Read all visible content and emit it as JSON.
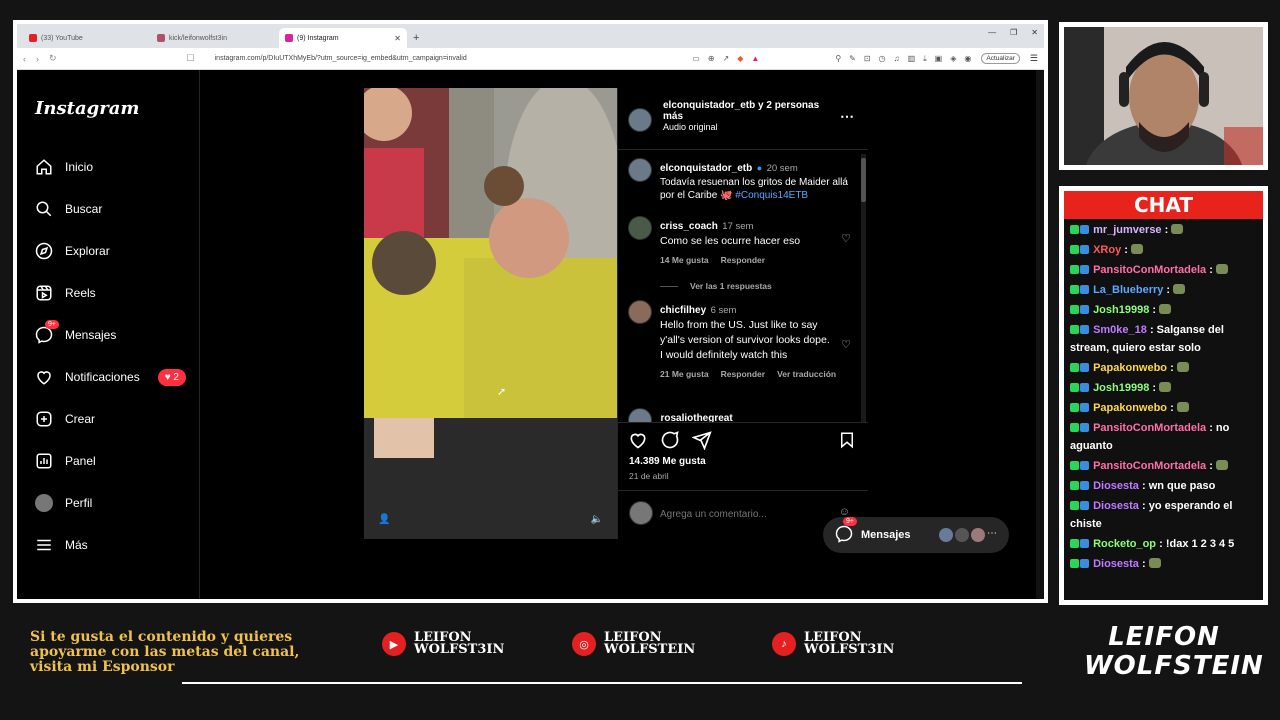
{
  "browser": {
    "tabs": [
      {
        "label": "(33) YouTube",
        "color": "#e52020"
      },
      {
        "label": "kick/leifonwolfst3in",
        "color": "#b0506a"
      },
      {
        "label": "(9) Instagram",
        "color": "#d6249f"
      }
    ],
    "url": "instagram.com/p/DIuUTXhMyEb/?utm_source=ig_embed&utm_campaign=invalid",
    "update_label": "Actualizar"
  },
  "instagram": {
    "logo": "Instagram",
    "nav": [
      {
        "label": "Inicio",
        "icon": "home-icon"
      },
      {
        "label": "Buscar",
        "icon": "search-icon"
      },
      {
        "label": "Explorar",
        "icon": "compass-icon"
      },
      {
        "label": "Reels",
        "icon": "reels-icon"
      },
      {
        "label": "Mensajes",
        "icon": "messenger-icon",
        "badge": "9+"
      },
      {
        "label": "Notificaciones",
        "icon": "heart-icon",
        "pill": "2"
      },
      {
        "label": "Crear",
        "icon": "plus-square-icon"
      },
      {
        "label": "Panel",
        "icon": "chart-icon"
      },
      {
        "label": "Perfil",
        "icon": "avatar-icon"
      },
      {
        "label": "Más",
        "icon": "menu-icon"
      }
    ],
    "post": {
      "header_title": "elconquistador_etb y 2 personas más",
      "header_sub": "Audio original",
      "caption_author": "elconquistador_etb",
      "caption_time": "20 sem",
      "caption_text": "Todavía resuenan los gritos de Maider allá por el Caribe",
      "caption_tag": "#Conquis14ETB",
      "comments": [
        {
          "author": "criss_coach",
          "time": "17 sem",
          "text": "Como se les ocurre hacer eso",
          "likes": "14 Me gusta",
          "reply": "Responder",
          "replies": "Ver las 1 respuestas"
        },
        {
          "author": "chicfilhey",
          "time": "6 sem",
          "text": "Hello from the US. Just like to say y'all's version of survivor looks dope. I would definitely watch this",
          "likes": "21 Me gusta",
          "reply": "Responder",
          "translate": "Ver traducción"
        }
      ],
      "partial_author": "rosaliothegreat",
      "likes": "14.389 Me gusta",
      "date": "21 de abril",
      "comment_placeholder": "Agrega un comentario..."
    },
    "messages_pill": {
      "label": "Mensajes",
      "badge": "9+"
    }
  },
  "chat": {
    "title": "CHAT",
    "messages": [
      {
        "user": "mr_jumverse",
        "color": "#d8b4ff",
        "text": ""
      },
      {
        "user": "XRoy",
        "color": "#ff5a5a",
        "text": ""
      },
      {
        "user": "PansitoConMortadela",
        "color": "#ff6fa8",
        "text": ""
      },
      {
        "user": "La_Blueberry",
        "color": "#5aa8ff",
        "text": ""
      },
      {
        "user": "Josh19998",
        "color": "#8cff7a",
        "text": ""
      },
      {
        "user": "Sm0ke_18",
        "color": "#c07aff",
        "text": "Salganse del stream, quiero estar solo"
      },
      {
        "user": "Papakonwebo",
        "color": "#ffd84a",
        "text": ""
      },
      {
        "user": "Josh19998",
        "color": "#8cff7a",
        "text": ""
      },
      {
        "user": "Papakonwebo",
        "color": "#ffd84a",
        "text": ""
      },
      {
        "user": "PansitoConMortadela",
        "color": "#ff6fa8",
        "text": "no aguanto"
      },
      {
        "user": "PansitoConMortadela",
        "color": "#ff6fa8",
        "text": ""
      },
      {
        "user": "Diosesta",
        "color": "#c07aff",
        "text": "wn que paso"
      },
      {
        "user": "Diosesta",
        "color": "#c07aff",
        "text": "yo esperando el chiste"
      },
      {
        "user": "Rocketo_op",
        "color": "#8cff7a",
        "text": "!dax 1 2 3 4 5"
      },
      {
        "user": "Diosesta",
        "color": "#c07aff",
        "text": ""
      }
    ]
  },
  "overlay": {
    "promo": "Si te gusta el contenido y quieres apoyarme con las metas del canal, visita mi Esponsor",
    "socials": [
      {
        "icon": "youtube-icon",
        "line1": "LEIFON",
        "line2": "WOLFST3IN"
      },
      {
        "icon": "instagram-icon",
        "line1": "LEIFON",
        "line2": "WOLFSTEIN"
      },
      {
        "icon": "tiktok-icon",
        "line1": "LEIFON",
        "line2": "WOLFST3IN"
      }
    ],
    "brand_line1": "LEIFON",
    "brand_line2": "WOLFSTEIN"
  }
}
